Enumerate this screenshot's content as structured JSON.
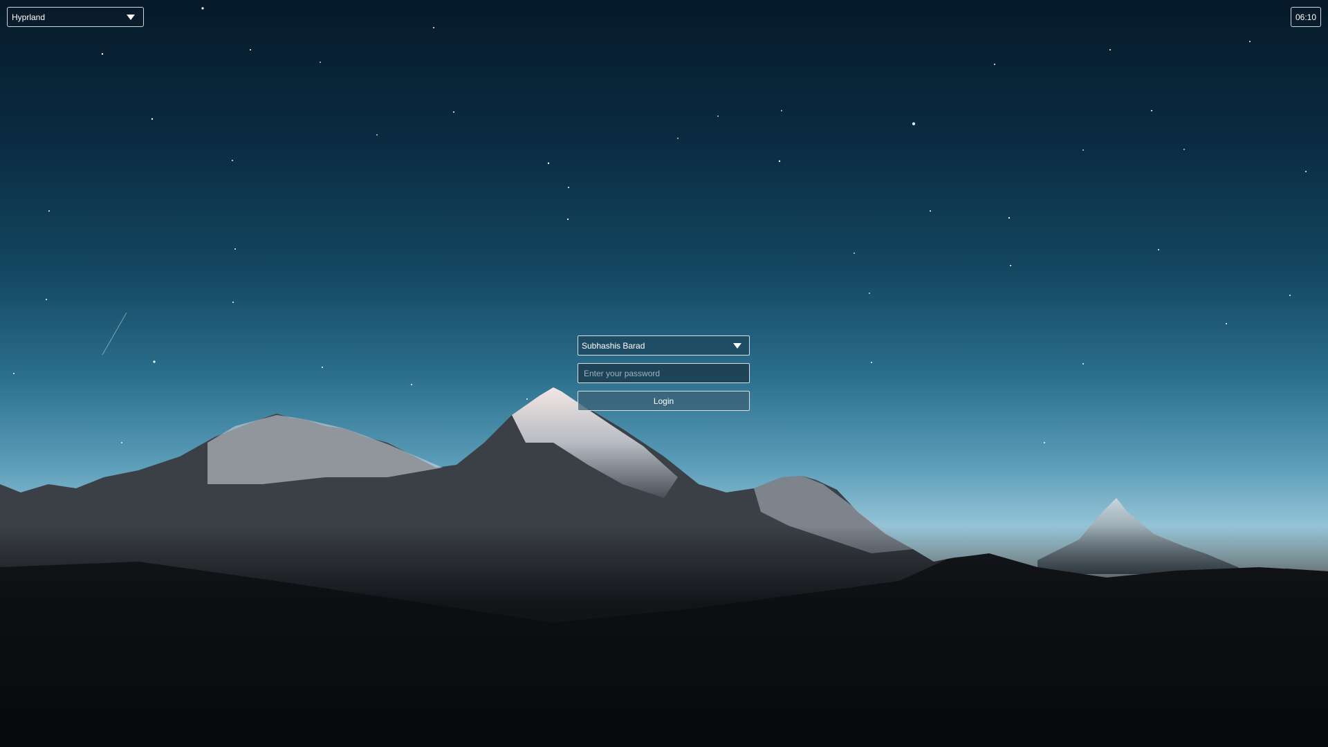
{
  "session": {
    "selected": "Hyprland",
    "icon": "chevron-down-icon"
  },
  "clock": {
    "time": "06:10"
  },
  "login": {
    "user_selected": "Subhashis Barad",
    "password_placeholder": "Enter your password",
    "login_label": "Login"
  },
  "colors": {
    "sky_top": "#061a2a",
    "sky_horizon": "#eef6f4",
    "ground": "#0c0e11"
  }
}
